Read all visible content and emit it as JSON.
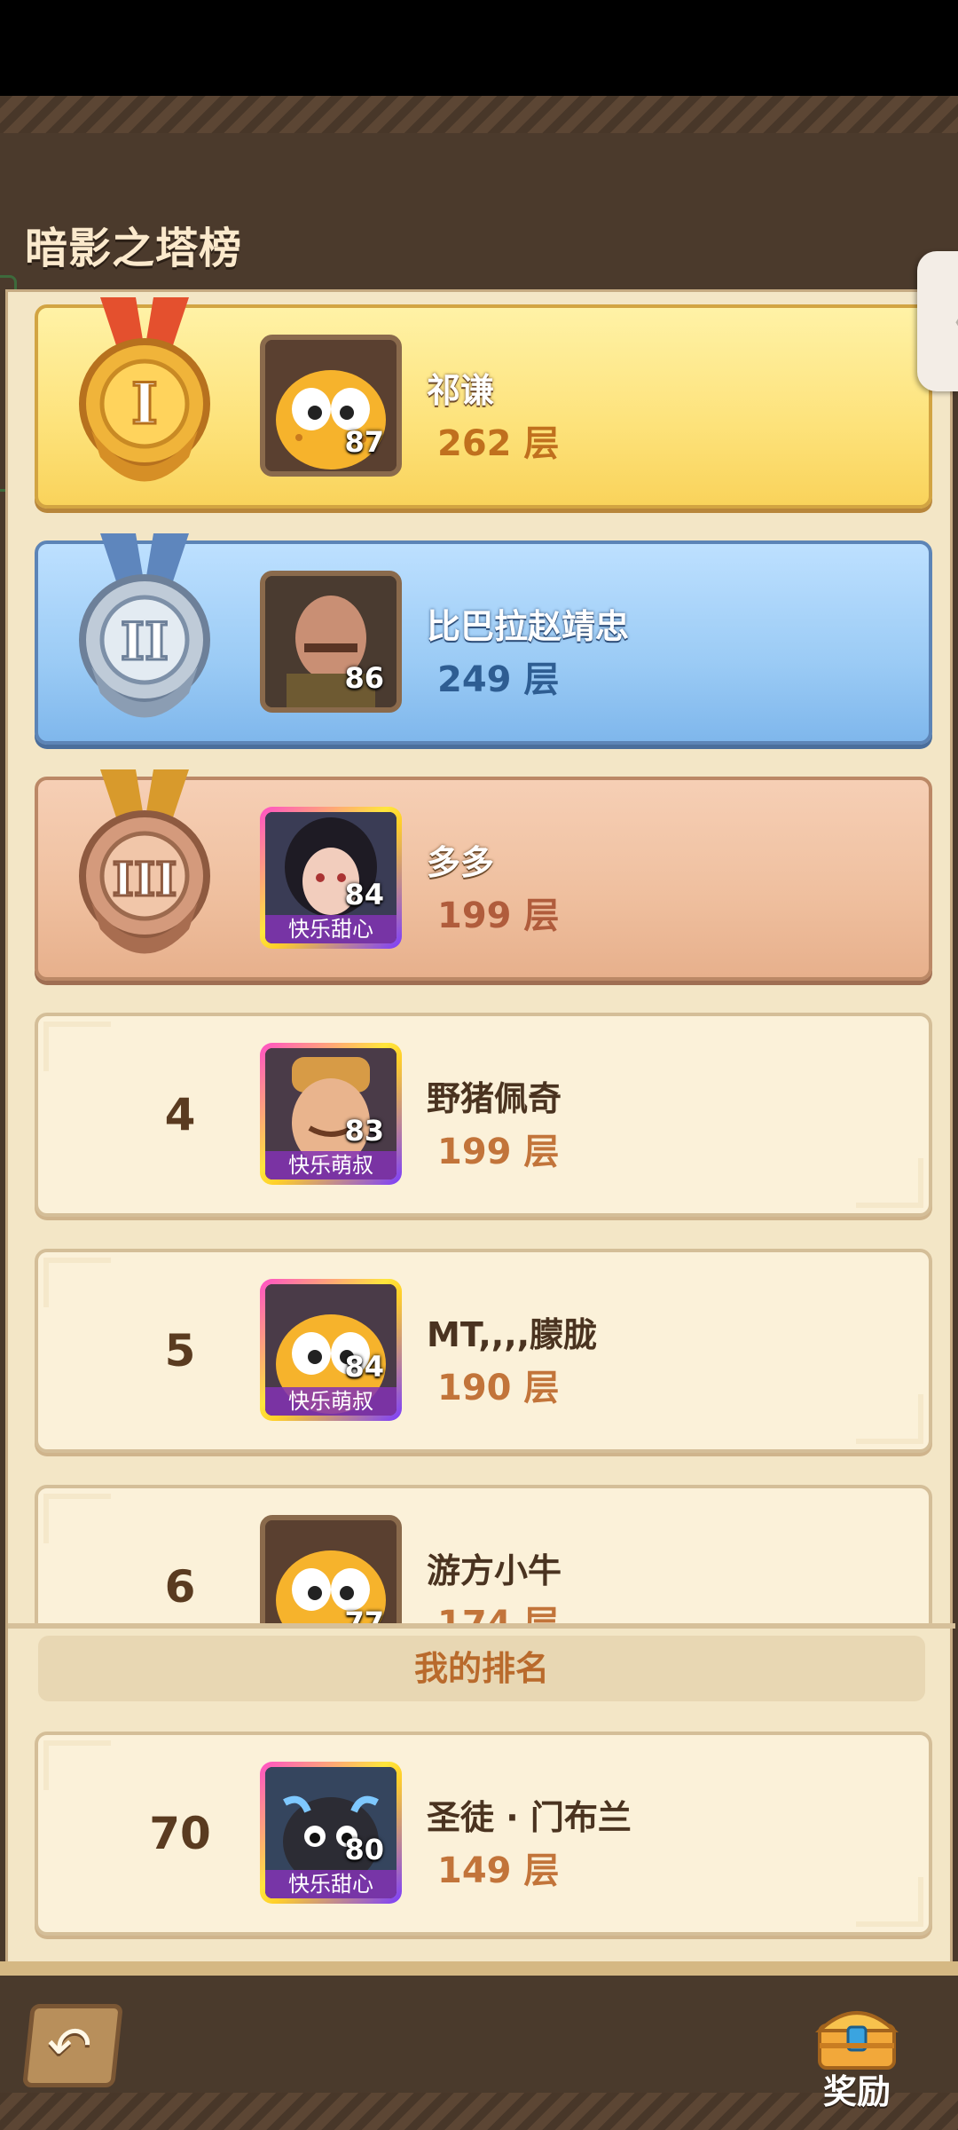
{
  "page": {
    "title": "暗影之塔榜",
    "side_tab_glyph": "〈"
  },
  "rankings": [
    {
      "rank": "",
      "medal": "I",
      "name": "祁谦",
      "level": "87",
      "floors": "262 层",
      "tag": "",
      "avatar": "yellow-blob-avatar"
    },
    {
      "rank": "",
      "medal": "II",
      "name": "比巴拉赵靖忠",
      "level": "86",
      "floors": "249 层",
      "tag": "",
      "avatar": "bald-warrior-avatar"
    },
    {
      "rank": "",
      "medal": "III",
      "name": "多多",
      "level": "84",
      "floors": "199 层",
      "tag": "快乐甜心",
      "avatar": "dark-hair-girl-avatar"
    },
    {
      "rank": "4",
      "medal": "",
      "name": "野猪佩奇",
      "level": "83",
      "floors": "199 层",
      "tag": "快乐萌叔",
      "avatar": "blond-man-avatar"
    },
    {
      "rank": "5",
      "medal": "",
      "name": "MT,,,,朦胧",
      "level": "84",
      "floors": "190 层",
      "tag": "快乐萌叔",
      "avatar": "yellow-blob-avatar"
    },
    {
      "rank": "6",
      "medal": "",
      "name": "游方小牛",
      "level": "77",
      "floors": "174 层",
      "tag": "",
      "avatar": "yellow-blob-avatar"
    }
  ],
  "my_rank": {
    "label": "我的排名",
    "rank": "70",
    "name": "圣徒 · 门布兰",
    "level": "80",
    "floors": "149 层",
    "tag": "快乐甜心",
    "avatar": "black-creature-avatar"
  },
  "bottom": {
    "back_icon": "back-arrow-icon",
    "back_glyph": "↶",
    "reward_label": "奖励",
    "reward_icon": "treasure-chest-icon"
  },
  "colors": {
    "gold": "#fde27a",
    "silver": "#9bcbf5",
    "bronze": "#efbf9e",
    "normal": "#fbf1d9",
    "floors_text": "#c2743a"
  }
}
